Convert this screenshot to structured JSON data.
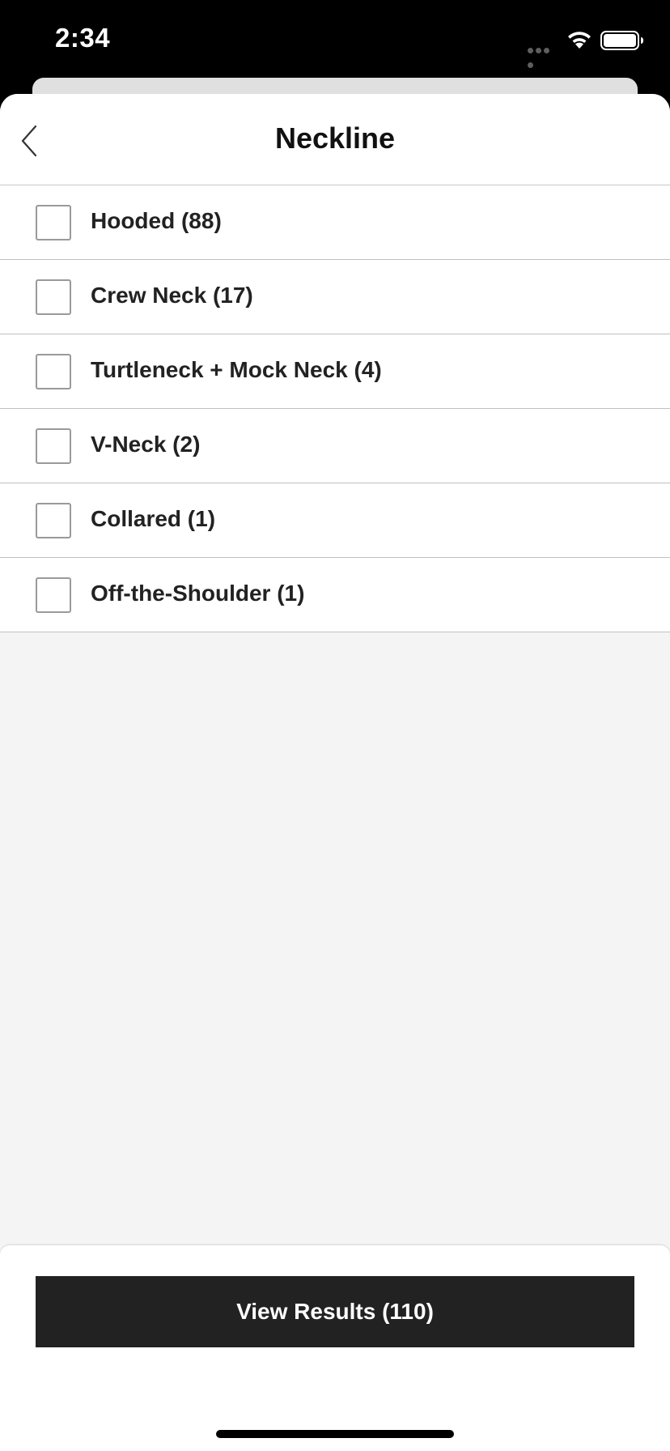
{
  "status_bar": {
    "time": "2:34",
    "signal_icon": "cellular-dots-icon",
    "wifi_icon": "wifi-icon",
    "battery_icon": "battery-full-icon"
  },
  "header": {
    "title": "Neckline",
    "back_icon": "chevron-left-icon"
  },
  "options": [
    {
      "label": "Hooded (88)",
      "checked": false
    },
    {
      "label": "Crew Neck (17)",
      "checked": false
    },
    {
      "label": "Turtleneck + Mock Neck (4)",
      "checked": false
    },
    {
      "label": "V-Neck (2)",
      "checked": false
    },
    {
      "label": "Collared (1)",
      "checked": false
    },
    {
      "label": "Off-the-Shoulder (1)",
      "checked": false
    }
  ],
  "footer": {
    "view_results_label": "View Results (110)"
  },
  "colors": {
    "button_bg": "#222222",
    "sheet_bg": "#f4f4f4",
    "divider": "#c0c0c0"
  }
}
